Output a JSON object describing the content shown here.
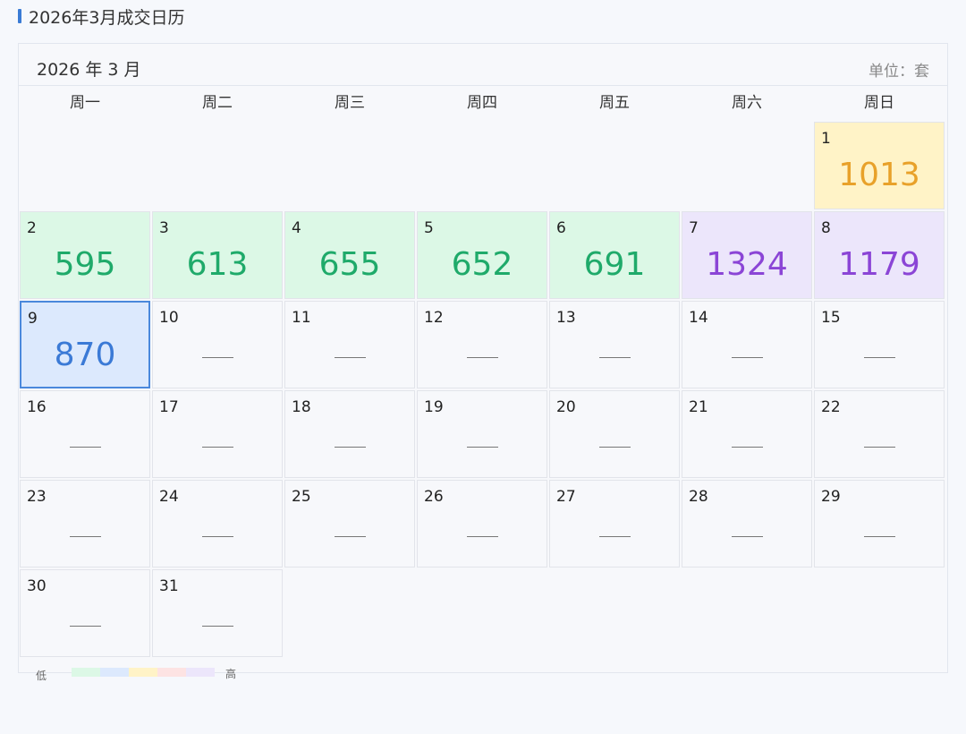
{
  "page_title": "2026年3月成交日历",
  "calendar": {
    "month_label": "2026 年 3 月",
    "unit_label": "单位：套",
    "weekdays": [
      "周一",
      "周二",
      "周三",
      "周四",
      "周五",
      "周六",
      "周日"
    ],
    "empty_mark": "——",
    "days": [
      {
        "day": "1",
        "value": "1013",
        "level": "yellow"
      },
      {
        "day": "2",
        "value": "595",
        "level": "green"
      },
      {
        "day": "3",
        "value": "613",
        "level": "green"
      },
      {
        "day": "4",
        "value": "655",
        "level": "green"
      },
      {
        "day": "5",
        "value": "652",
        "level": "green"
      },
      {
        "day": "6",
        "value": "691",
        "level": "green"
      },
      {
        "day": "7",
        "value": "1324",
        "level": "purple"
      },
      {
        "day": "8",
        "value": "1179",
        "level": "purple"
      },
      {
        "day": "9",
        "value": "870",
        "level": "blue",
        "selected": true
      },
      {
        "day": "10"
      },
      {
        "day": "11"
      },
      {
        "day": "12"
      },
      {
        "day": "13"
      },
      {
        "day": "14"
      },
      {
        "day": "15"
      },
      {
        "day": "16"
      },
      {
        "day": "17"
      },
      {
        "day": "18"
      },
      {
        "day": "19"
      },
      {
        "day": "20"
      },
      {
        "day": "21"
      },
      {
        "day": "22"
      },
      {
        "day": "23"
      },
      {
        "day": "24"
      },
      {
        "day": "25"
      },
      {
        "day": "26"
      },
      {
        "day": "27"
      },
      {
        "day": "28"
      },
      {
        "day": "29"
      },
      {
        "day": "30"
      },
      {
        "day": "31"
      }
    ],
    "start_weekday_index": 6
  },
  "legend": {
    "low_label": "低",
    "high_label": "高",
    "colors": [
      "#dcf8e6",
      "#dce9fd",
      "#fff3c7",
      "#fde3e3",
      "#ece6fb"
    ]
  },
  "colors": {
    "accent": "#3a7bd5",
    "green": "#1faa6a",
    "yellow": "#e8a12a",
    "purple": "#8b45d6",
    "blue": "#3b7ad6"
  }
}
